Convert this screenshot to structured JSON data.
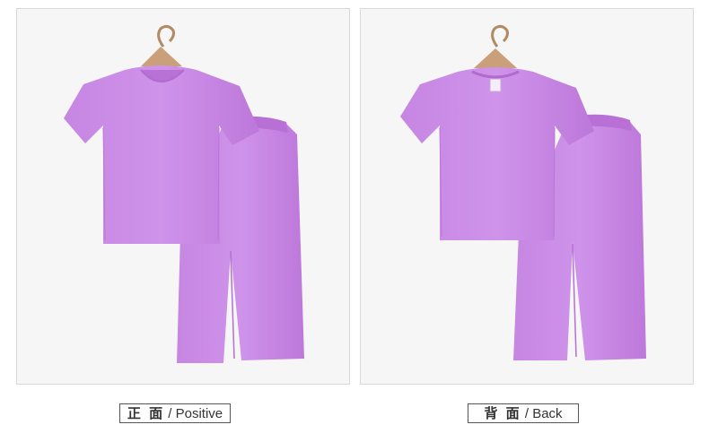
{
  "captions": {
    "front": {
      "zh": "正 面",
      "en": " / Positive"
    },
    "back": {
      "zh": "背 面",
      "en": " / Back"
    }
  },
  "colors": {
    "garment": "#c987e3",
    "garment_shadow": "#b670d4",
    "hanger": "#c9a07a",
    "panel_background": "#f6f6f6",
    "caption_border": "#555555"
  },
  "icons": [
    "hanger-icon",
    "t-shirt-image",
    "pants-image"
  ]
}
